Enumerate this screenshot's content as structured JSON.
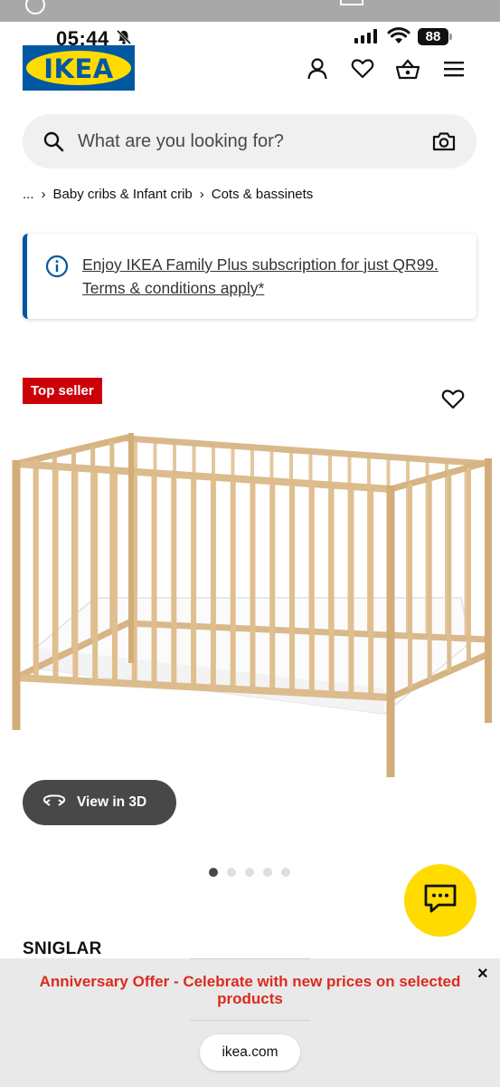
{
  "status_bar": {
    "time": "05:44",
    "battery": "88"
  },
  "brand": {
    "logo_text": "IKEA",
    "logo_bg": "#0058a3",
    "logo_oval": "#ffdb00"
  },
  "header": {
    "icons": [
      "user-icon",
      "heart-icon",
      "basket-icon",
      "menu-icon"
    ]
  },
  "search": {
    "placeholder": "What are you looking for?"
  },
  "breadcrumb": {
    "ellipsis": "...",
    "items": [
      "Baby cribs & Infant crib",
      "Cots & bassinets"
    ]
  },
  "notice": {
    "text": "Enjoy IKEA Family Plus subscription for just QR99. Terms & conditions apply*",
    "accent": "#0058a3"
  },
  "product": {
    "badge": "Top seller",
    "badge_color": "#cc0008",
    "view_3d_label": "View in 3D",
    "image_count": 5,
    "active_image": 1,
    "name": "SNIGLAR"
  },
  "chat": {
    "color": "#ffdb00"
  },
  "banner": {
    "offer_text": "Anniversary Offer - Celebrate with new prices on selected products",
    "offer_color": "#dc2a1e",
    "close_symbol": "×",
    "url": "ikea.com"
  }
}
